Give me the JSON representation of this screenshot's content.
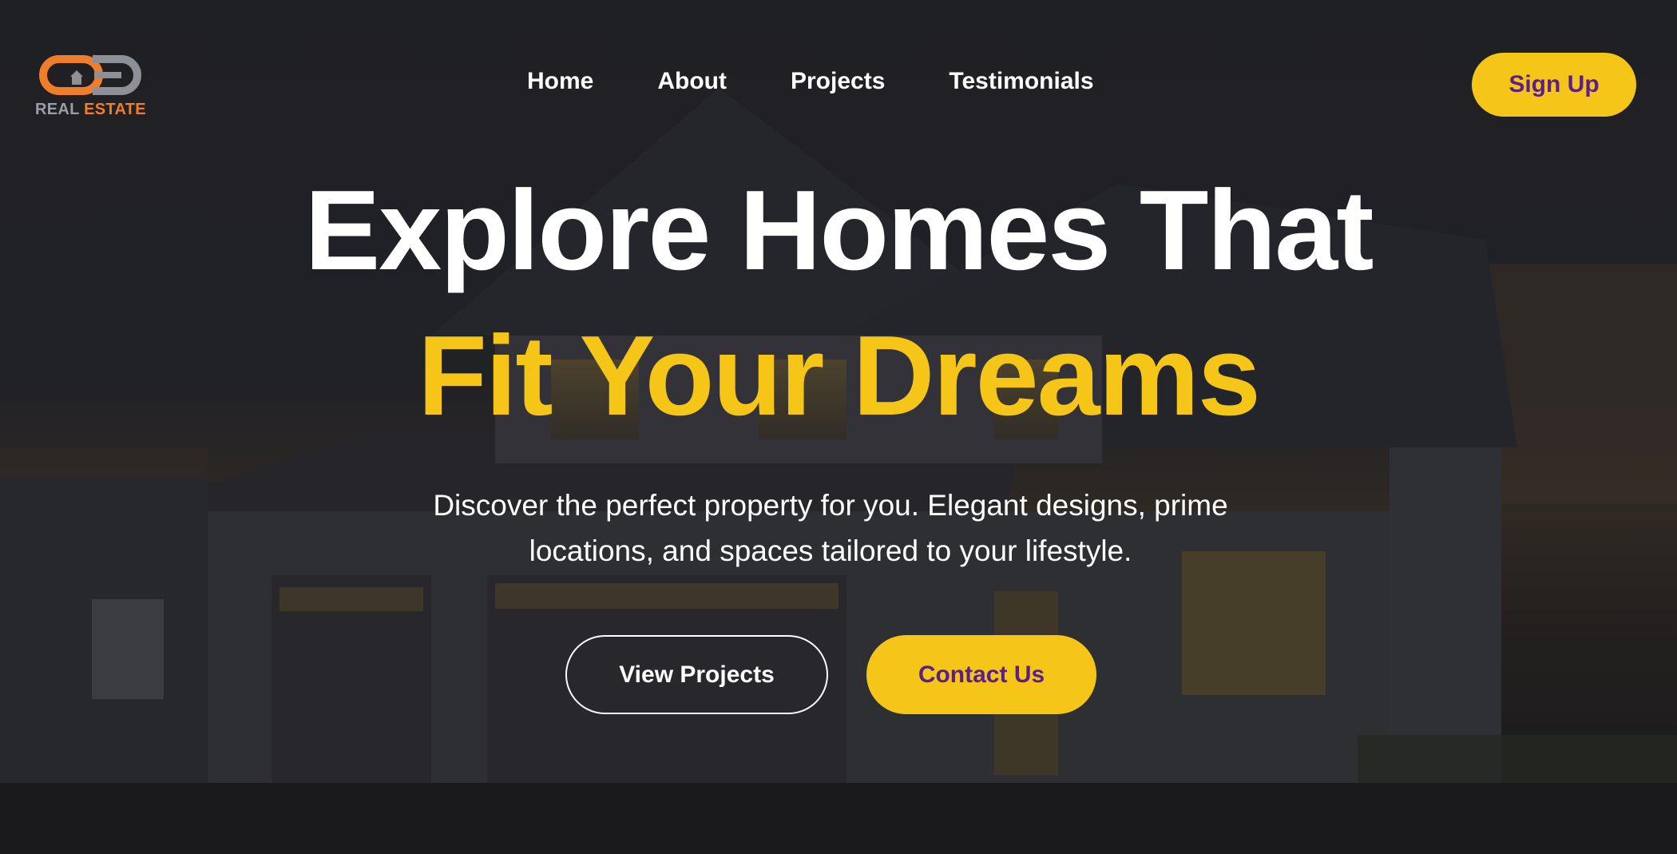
{
  "brand": {
    "logo_icon": "re-monogram-logo",
    "word_1": "REAL",
    "word_2": "ESTATE",
    "colors": {
      "orange": "#f07d2a",
      "gray": "#8d9097"
    }
  },
  "nav": {
    "items": [
      {
        "label": "Home"
      },
      {
        "label": "About"
      },
      {
        "label": "Projects"
      },
      {
        "label": "Testimonials"
      }
    ]
  },
  "header": {
    "signup_label": "Sign Up"
  },
  "hero": {
    "headline_line_1": "Explore Homes That",
    "headline_line_2": "Fit Your Dreams",
    "subtitle": "Discover the perfect property for you. Elegant designs, prime locations, and spaces tailored to your lifestyle.",
    "primary_button": "View Projects",
    "secondary_button": "Contact Us",
    "background_image": "house-at-dusk-photo"
  },
  "colors": {
    "accent_yellow": "#f5c518",
    "button_text_purple": "#5b1f8a",
    "text_white": "#ffffff",
    "background_dark": "#1f2026"
  }
}
